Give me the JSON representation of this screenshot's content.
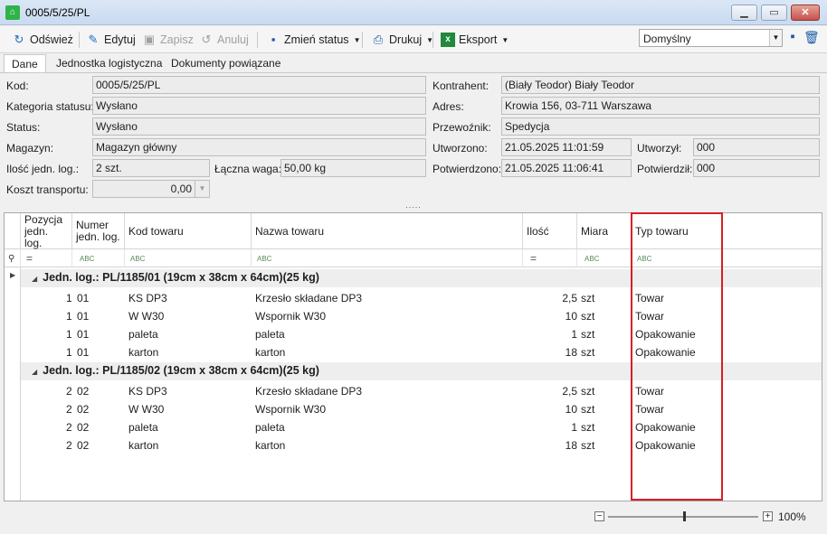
{
  "window": {
    "title": "0005/5/25/PL"
  },
  "toolbar": {
    "refresh": "Odśwież",
    "edit": "Edytuj",
    "save": "Zapisz",
    "cancel": "Anuluj",
    "change_status": "Zmień status",
    "print": "Drukuj",
    "export": "Eksport",
    "layout_value": "Domyślny"
  },
  "tabs": [
    "Dane",
    "Jednostka logistyczna",
    "Dokumenty powiązane"
  ],
  "form": {
    "kod_label": "Kod:",
    "kod": "0005/5/25/PL",
    "kategoria_label": "Kategoria statusu:",
    "kategoria": "Wysłano",
    "status_label": "Status:",
    "status": "Wysłano",
    "magazyn_label": "Magazyn:",
    "magazyn": "Magazyn główny",
    "ilosc_label": "Ilość jedn. log.:",
    "ilosc": "2 szt.",
    "waga_label": "Łączna waga:",
    "waga": "50,00 kg",
    "koszt_label": "Koszt transportu:",
    "koszt": "0,00",
    "kontrahent_label": "Kontrahent:",
    "kontrahent": "(Biały Teodor) Biały Teodor",
    "adres_label": "Adres:",
    "adres": "Krowia 156, 03-711 Warszawa",
    "przewoznik_label": "Przewoźnik:",
    "przewoznik": "Spedycja",
    "utworzono_label": "Utworzono:",
    "utworzono": "21.05.2025 11:01:59",
    "utworzyl_label": "Utworzył:",
    "utworzyl": "000",
    "potwierdzono_label": "Potwierdzono:",
    "potwierdzono": "21.05.2025 11:06:41",
    "potwierdzil_label": "Potwierdził:",
    "potwierdzil": "000"
  },
  "grid": {
    "columns": {
      "pozycja": "Pozycja jedn. log.",
      "numer": "Numer jedn. log.",
      "kod": "Kod towaru",
      "nazwa": "Nazwa towaru",
      "ilosc": "Ilość",
      "miara": "Miara",
      "typ": "Typ towaru"
    },
    "groups": [
      {
        "label": "Jedn. log.: PL/1185/01 (19cm x 38cm x 64cm)(25 kg)",
        "rows": [
          {
            "poz": "1",
            "num": "01",
            "kod": "KS DP3",
            "nazwa": "Krzesło składane DP3",
            "ilosc": "2,5",
            "miara": "szt",
            "typ": "Towar"
          },
          {
            "poz": "1",
            "num": "01",
            "kod": "W W30",
            "nazwa": "Wspornik W30",
            "ilosc": "10",
            "miara": "szt",
            "typ": "Towar"
          },
          {
            "poz": "1",
            "num": "01",
            "kod": "paleta",
            "nazwa": "paleta",
            "ilosc": "1",
            "miara": "szt",
            "typ": "Opakowanie"
          },
          {
            "poz": "1",
            "num": "01",
            "kod": "karton",
            "nazwa": "karton",
            "ilosc": "18",
            "miara": "szt",
            "typ": "Opakowanie"
          }
        ]
      },
      {
        "label": "Jedn. log.: PL/1185/02 (19cm x 38cm x 64cm)(25 kg)",
        "rows": [
          {
            "poz": "2",
            "num": "02",
            "kod": "KS DP3",
            "nazwa": "Krzesło składane DP3",
            "ilosc": "2,5",
            "miara": "szt",
            "typ": "Towar"
          },
          {
            "poz": "2",
            "num": "02",
            "kod": "W W30",
            "nazwa": "Wspornik W30",
            "ilosc": "10",
            "miara": "szt",
            "typ": "Towar"
          },
          {
            "poz": "2",
            "num": "02",
            "kod": "paleta",
            "nazwa": "paleta",
            "ilosc": "1",
            "miara": "szt",
            "typ": "Opakowanie"
          },
          {
            "poz": "2",
            "num": "02",
            "kod": "karton",
            "nazwa": "karton",
            "ilosc": "18",
            "miara": "szt",
            "typ": "Opakowanie"
          }
        ]
      }
    ]
  },
  "zoom": {
    "value": "100%"
  },
  "highlight_color": "#d61f26"
}
